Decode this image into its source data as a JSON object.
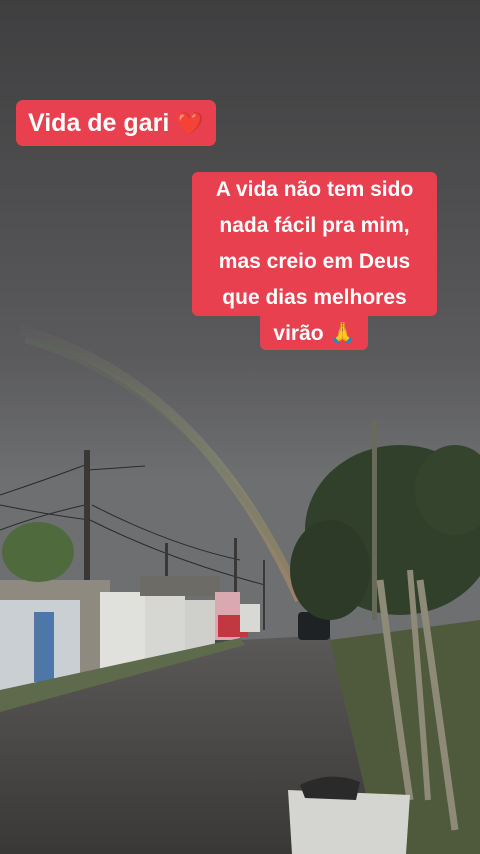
{
  "captions": {
    "title": "Vida de gari",
    "title_emoji": "❤️",
    "message_lines": [
      "A vida não tem sido",
      "nada fácil pra mim,",
      "mas creio em Deus",
      "que dias melhores",
      "virão"
    ],
    "message_emoji": "🙏"
  },
  "colors": {
    "caption_background": "#e8404f",
    "caption_text": "#ffffff"
  }
}
